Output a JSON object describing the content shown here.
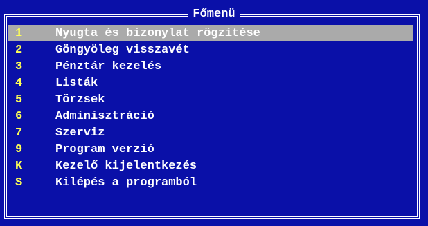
{
  "menu": {
    "title": "Főmenü",
    "items": [
      {
        "key": "1",
        "label": "Nyugta és bizonylat rögzítése",
        "selected": true
      },
      {
        "key": "2",
        "label": "Göngyöleg visszavét",
        "selected": false
      },
      {
        "key": "3",
        "label": "Pénztár kezelés",
        "selected": false
      },
      {
        "key": "4",
        "label": "Listák",
        "selected": false
      },
      {
        "key": "5",
        "label": "Törzsek",
        "selected": false
      },
      {
        "key": "6",
        "label": "Adminisztráció",
        "selected": false
      },
      {
        "key": "7",
        "label": "Szerviz",
        "selected": false
      },
      {
        "key": "9",
        "label": "Program verzió",
        "selected": false
      },
      {
        "key": "K",
        "label": "Kezelő kijelentkezés",
        "selected": false
      },
      {
        "key": "S",
        "label": "Kilépés a programból",
        "selected": false
      }
    ]
  },
  "colors": {
    "background": "#0a10a8",
    "text": "#ffffff",
    "hotkey": "#ffff55",
    "selection": "#aaaaaa"
  }
}
